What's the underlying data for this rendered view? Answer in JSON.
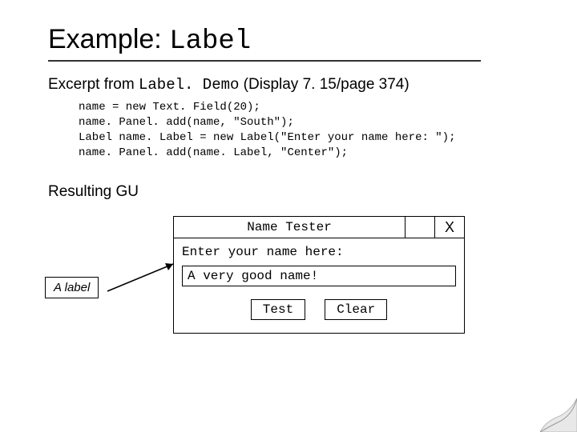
{
  "title": {
    "prefix": "Example: ",
    "mono": "Label"
  },
  "excerpt": {
    "prefix": "Excerpt from ",
    "mono": "Label. Demo",
    "suffix": " (Display 7. 15/page 374)"
  },
  "code": "name = new Text. Field(20);\nname. Panel. add(name, \"South\");\nLabel name. Label = new Label(\"Enter your name here: \");\nname. Panel. add(name. Label, \"Center\");",
  "resulting": "Resulting GU",
  "gui": {
    "title": "Name Tester",
    "close": "X",
    "label": "Enter your name here:",
    "input": "A very good name!",
    "btn_test": "Test",
    "btn_clear": "Clear"
  },
  "annotation": "A label"
}
